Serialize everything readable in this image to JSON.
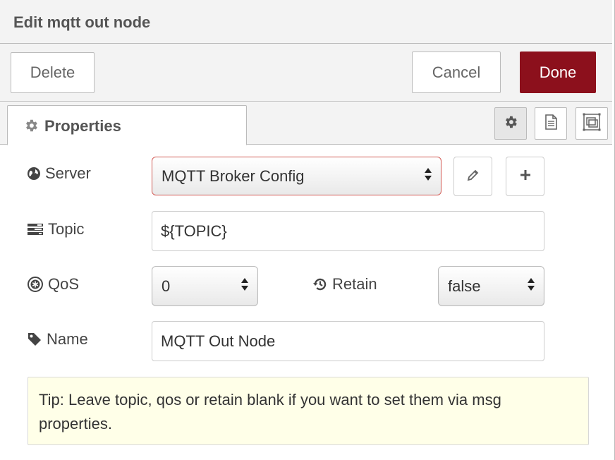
{
  "dialog": {
    "title": "Edit mqtt out node"
  },
  "toolbar": {
    "delete_label": "Delete",
    "cancel_label": "Cancel",
    "done_label": "Done",
    "done_color": "#8c101c"
  },
  "tabs": {
    "properties_label": "Properties",
    "icons": [
      "gear-icon",
      "description-icon",
      "appearance-icon"
    ]
  },
  "form": {
    "server": {
      "label": "Server",
      "value": "MQTT Broker Config",
      "icon": "globe-icon"
    },
    "topic": {
      "label": "Topic",
      "value": "${TOPIC}",
      "icon": "tasks-icon"
    },
    "qos": {
      "label": "QoS",
      "value": "0",
      "icon": "qos-icon"
    },
    "retain": {
      "label": "Retain",
      "value": "false",
      "icon": "history-icon"
    },
    "name": {
      "label": "Name",
      "value": "MQTT Out Node",
      "icon": "tag-icon"
    }
  },
  "tip": {
    "text": "Tip: Leave topic, qos or retain blank if you want to set them via msg properties."
  }
}
